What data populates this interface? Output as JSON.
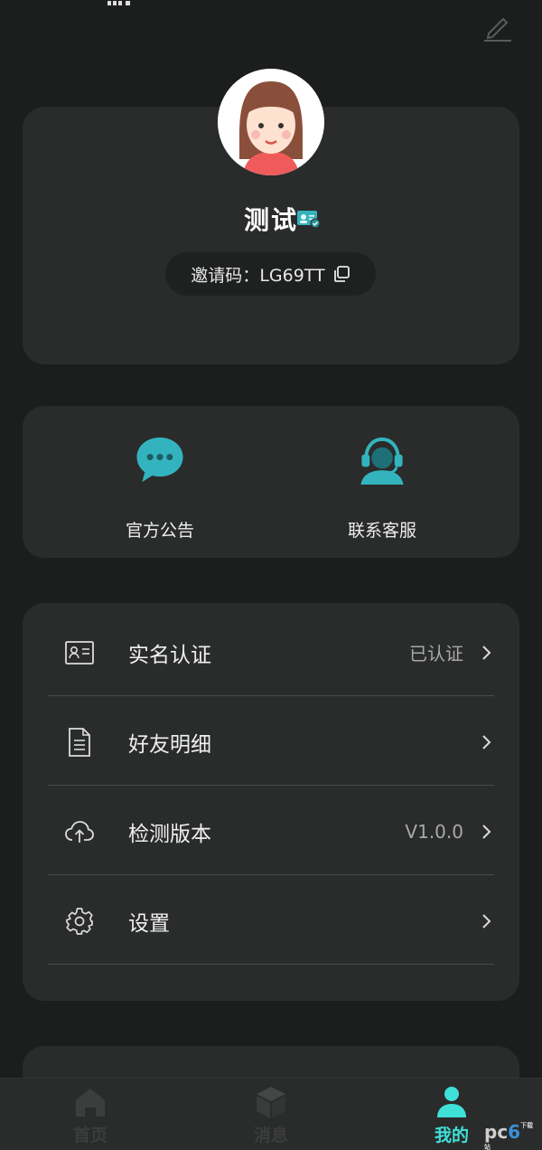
{
  "profile": {
    "username": "测试",
    "invite_label": "邀请码：",
    "invite_code": "LG69TT"
  },
  "shortcuts": [
    {
      "label": "官方公告",
      "icon": "chat-bubble-icon"
    },
    {
      "label": "联系客服",
      "icon": "customer-service-icon"
    }
  ],
  "menu": [
    {
      "label": "实名认证",
      "value": "已认证",
      "icon": "id-card-icon"
    },
    {
      "label": "好友明细",
      "value": "",
      "icon": "document-icon"
    },
    {
      "label": "检测版本",
      "value": "V1.0.0",
      "icon": "cloud-upload-icon"
    },
    {
      "label": "设置",
      "value": "",
      "icon": "gear-icon"
    }
  ],
  "tabs": [
    {
      "label": "首页",
      "icon": "home-icon",
      "active": false
    },
    {
      "label": "消息",
      "icon": "cube-icon",
      "active": false
    },
    {
      "label": "我的",
      "icon": "person-icon",
      "active": true
    }
  ],
  "colors": {
    "background": "#1c1d1d",
    "card": "#2a2b2b",
    "accent": "#3fe0d8",
    "icon_teal": "#33b3bd"
  },
  "watermark": {
    "prefix": "pc",
    "digit": "6",
    "suffix": "下载站"
  }
}
